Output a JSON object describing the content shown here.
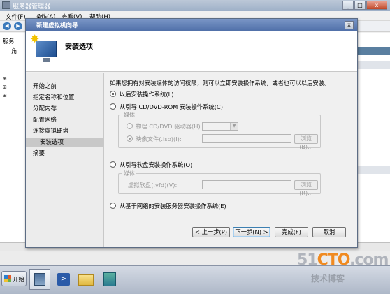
{
  "bg": {
    "title": "服务器管理器",
    "menu": [
      "文件(F)",
      "操作(A)",
      "查看(V)",
      "帮助(H)"
    ],
    "tree_label": "服务",
    "tree_sub": "角"
  },
  "wizard": {
    "title": "新建虚拟机向导",
    "close": "x",
    "heading": "安装选项",
    "nav": [
      {
        "label": "开始之前"
      },
      {
        "label": "指定名称和位置"
      },
      {
        "label": "分配内存"
      },
      {
        "label": "配置网络"
      },
      {
        "label": "连接虚拟硬盘"
      },
      {
        "label": "安装选项"
      },
      {
        "label": "摘要"
      }
    ],
    "intro": "如果您拥有对安装媒体的访问权限，则可以立即安装操作系统，或者也可以以后安装。",
    "opt_later": "以后安装操作系统(L)",
    "opt_cd": "从引导 CD/DVD-ROM 安装操作系统(C)",
    "media_label": "媒体",
    "opt_physical": "物理 CD/DVD 驱动器(H):",
    "opt_iso": "映像文件(.iso)(I):",
    "browse": "浏览(B)...",
    "opt_floppy": "从引导软盘安装操作系统(O)",
    "media_label2": "媒体",
    "vfd_label": "虚拟软盘(.vfd)(V):",
    "browse2": "浏览(R)...",
    "opt_network": "从基于网络的安装服务器安装操作系统(E)",
    "buttons": {
      "prev": "< 上一步(P)",
      "next": "下一步(N) >",
      "finish": "完成(F)",
      "cancel": "取消"
    }
  },
  "taskbar": {
    "start": "开始"
  },
  "watermark": {
    "line1a": "51",
    "line1b": "CTO",
    "line1c": ".com",
    "line2": "技术博客"
  }
}
